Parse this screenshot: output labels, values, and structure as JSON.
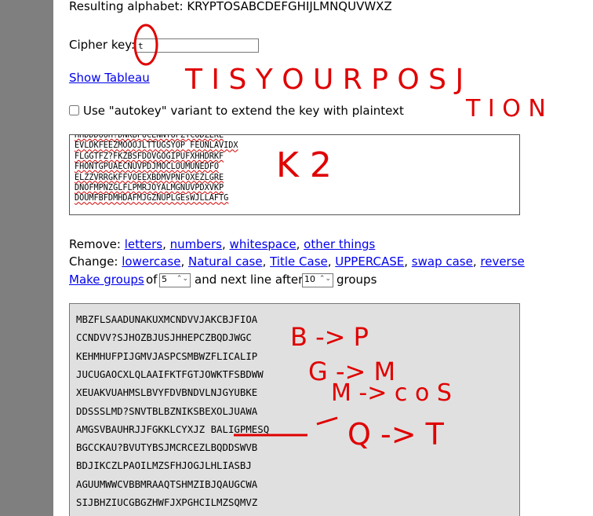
{
  "resulting_alphabet": "Resulting alphabet: KRYPTOSABCDEFGHIJLMNQUVWXZ",
  "cipher_key_label": "Cipher key:",
  "cipher_key_value": "t",
  "show_tableau": "Show Tableau",
  "autokey_label": "Use \"autokey\" variant to extend the key with plaintext",
  "input_lines": [
    "HHDDDUUH?DNKBFUCENNTUPZTCUDZEKE",
    "EVLDKFEEZMOOOJLTTUGSYOP FEUNLAVIDX",
    "FLGGTFZ?FKZBSFDOVGOGIPUFXHHDRKF",
    "FHONTGPUAECNUVPDJMOCLOUMUNEDFO",
    "ELZZVRRGKFFVOEEXBDMVPNFOXEZLGRE",
    "DNOFMPNZGLFLPMRJOYALMGNUVPDXVKP",
    "DOUMFBFDMHDAFMJGZNUPLGEsWJLLAFTG"
  ],
  "remove": {
    "label": "Remove:",
    "links": [
      "letters",
      "numbers",
      "whitespace",
      "other things"
    ]
  },
  "change": {
    "label": "Change:",
    "links": [
      "lowercase",
      "Natural case",
      "Title Case",
      "UPPERCASE",
      "swap case",
      "reverse"
    ]
  },
  "groups": {
    "make_groups": "Make groups",
    "of": "of",
    "group_size": "5",
    "next_line": "and next line after",
    "line_after": "10",
    "groups_word": "groups"
  },
  "output_lines": [
    "MBZFLSAADUNAKUXMCNDVVJAKCBJFIOA",
    "CCNDVV?SJHOZBJUSJHHEPCZBQDJWGC",
    "KEHMHUFPIJGMVJASPCSMBWZFLICALIP",
    "JUCUGAOCXLQLAAIFKTFGTJOWKTFSBDWW",
    "XEUAKVUAHMSLBVYFDVBNDVLNJGYUBKE",
    "DDSSSLMD?SNVTBLBZNIKSBEXOLJUAWA",
    "AMGSVBAUHRJJFGKKLCYXJZ BALIGPMESQ",
    "BGCCKAU?BVUTYBSJMCRCEZLBQDDSWVB",
    "BDJIKCZLPAOILMZSFHJOGJLHLIASBJ",
    "AGUUMWWCVBBMRAAQTSHMZIBJQAUGCWA",
    "SIJBHZIUCGBGZHWFJXPGHCILMZSQMVZ"
  ],
  "annotations": {
    "pos_row1": "T  I  S  Y  O  U  R     P      O    S    J",
    "pos_row2": "T   I   O   N",
    "k2": "K  2",
    "b_p": "B -> P",
    "g_m": "G -> M",
    "m_cos": "M -> c o S",
    "q_t": "Q -> T",
    "color": "#e00000"
  }
}
